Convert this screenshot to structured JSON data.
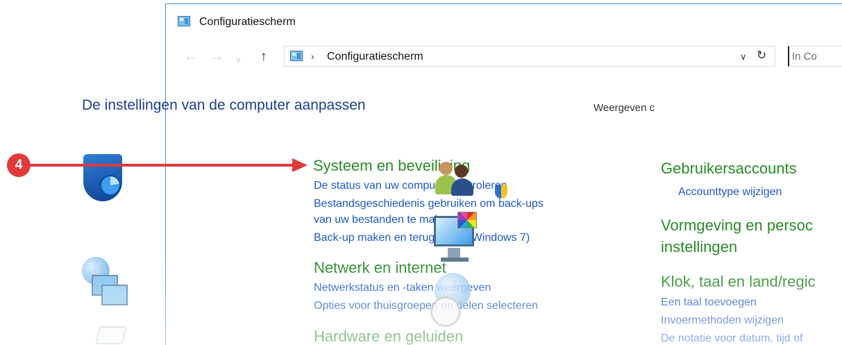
{
  "window": {
    "title": "Configuratiescherm"
  },
  "address": {
    "nav_back": "←",
    "nav_forward": "→",
    "nav_recent": "∨",
    "nav_up": "↑",
    "separator": "›",
    "path": "Configuratiescherm",
    "dropdown": "∨",
    "refresh": "↻",
    "search_placeholder": "In Co"
  },
  "main": {
    "heading": "De instellingen van de computer aanpassen",
    "view_by": "Weergeven c"
  },
  "categories": {
    "system": {
      "title": "Systeem en beveiliging",
      "links": [
        "De status van uw computer controleren",
        "Bestandsgeschiedenis gebruiken om back-ups",
        "van uw bestanden te maken",
        "Back-up maken en terugzetten (Windows 7)"
      ]
    },
    "network": {
      "title": "Netwerk en internet",
      "links": [
        "Netwerkstatus en -taken weergeven",
        "Opties voor thuisgroepen en delen selecteren"
      ]
    },
    "hardware": {
      "title": "Hardware en geluiden"
    },
    "users": {
      "title": "Gebruikersaccounts",
      "links": [
        "Accounttype wijzigen"
      ]
    },
    "appearance": {
      "title_line1": "Vormgeving en persoc",
      "title_line2": "instellingen"
    },
    "clock": {
      "title": "Klok, taal en land/regic",
      "links": [
        "Een taal toevoegen",
        "Invoermethoden wijzigen",
        "De notatie voor datum, tijd of"
      ]
    }
  },
  "annotation": {
    "step": "4",
    "color": "#e03a3a"
  },
  "colors": {
    "category_title": "#2a8a2a",
    "link": "#1f57c9",
    "heading": "#1e3f8f",
    "window_border": "#3c8fd6"
  }
}
